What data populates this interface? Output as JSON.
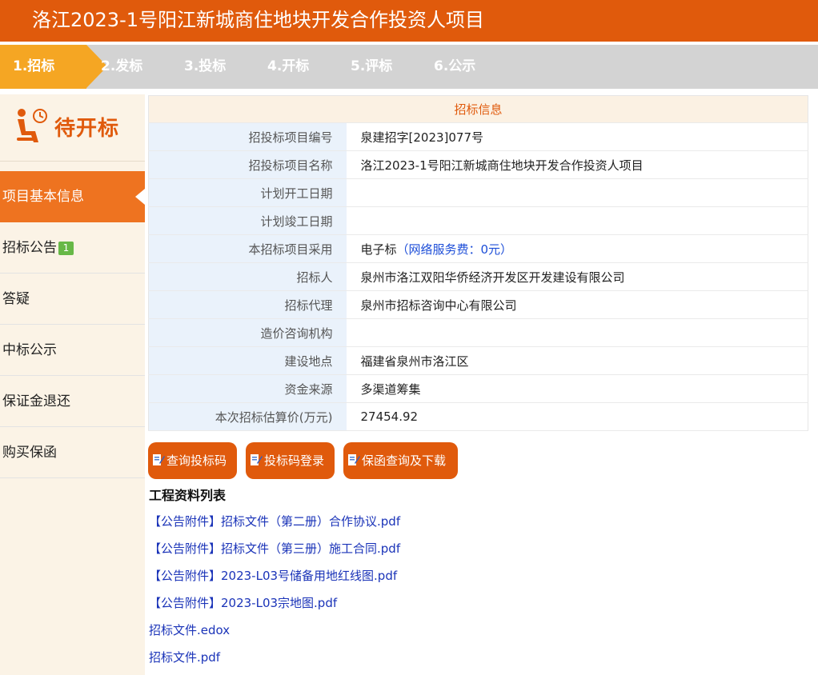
{
  "header": {
    "title": "洛江2023-1号阳江新城商住地块开发合作投资人项目"
  },
  "steps": [
    "1.招标",
    "2.发标",
    "3.投标",
    "4.开标",
    "5.评标",
    "6.公示"
  ],
  "sidebar": {
    "status": "待开标",
    "items": [
      {
        "label": "项目基本信息"
      },
      {
        "label": "招标公告",
        "badge": "1"
      },
      {
        "label": "答疑"
      },
      {
        "label": "中标公示"
      },
      {
        "label": "保证金退还"
      },
      {
        "label": "购买保函"
      }
    ]
  },
  "info": {
    "heading": "招标信息",
    "rows": [
      {
        "label": "招投标项目编号",
        "value": "泉建招字[2023]077号"
      },
      {
        "label": "招投标项目名称",
        "value": "洛江2023-1号阳江新城商住地块开发合作投资人项目"
      },
      {
        "label": "计划开工日期",
        "value": ""
      },
      {
        "label": "计划竣工日期",
        "value": ""
      },
      {
        "label": "本招标项目采用",
        "value": "电子标",
        "note": "（网络服务费：0元）"
      },
      {
        "label": "招标人",
        "value": "泉州市洛江双阳华侨经济开发区开发建设有限公司"
      },
      {
        "label": "招标代理",
        "value": "泉州市招标咨询中心有限公司"
      },
      {
        "label": "造价咨询机构",
        "value": ""
      },
      {
        "label": "建设地点",
        "value": "福建省泉州市洛江区"
      },
      {
        "label": "资金来源",
        "value": "多渠道筹集"
      },
      {
        "label": "本次招标估算价(万元)",
        "value": "27454.92"
      }
    ]
  },
  "buttons": {
    "query_code": "查询投标码",
    "code_login": "投标码登录",
    "guarantee": "保函查询及下载"
  },
  "files": {
    "title": "工程资料列表",
    "items": [
      "【公告附件】招标文件（第二册）合作协议.pdf",
      "【公告附件】招标文件（第三册）施工合同.pdf",
      "【公告附件】2023-L03号储备用地红线图.pdf",
      "【公告附件】2023-L03宗地图.pdf",
      "招标文件.edox",
      "招标文件.pdf"
    ]
  },
  "colors": {
    "brand": "#e05a0c",
    "step_active": "#f5a623",
    "sidebar_active": "#ee7320",
    "link": "#1a33b8",
    "badge": "#67b847"
  }
}
